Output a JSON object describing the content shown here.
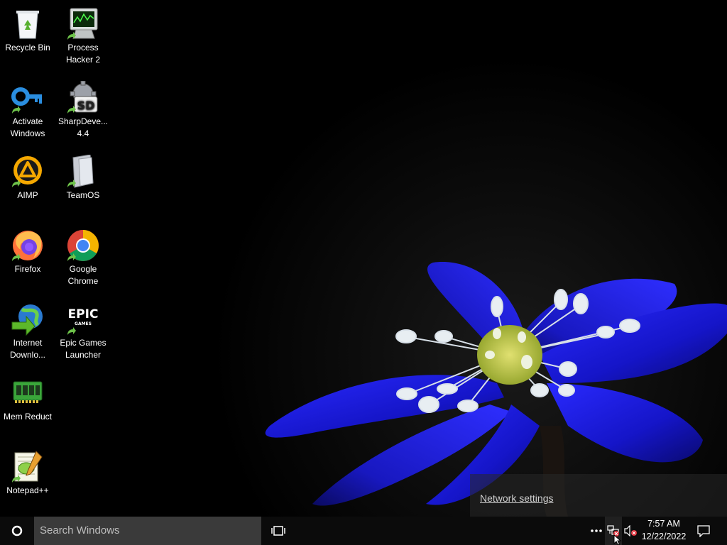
{
  "desktop": {
    "icons": [
      {
        "id": "recycle-bin",
        "label": "Recycle Bin",
        "icon": "recycle-bin-icon",
        "shortcut": false
      },
      {
        "id": "process-hacker",
        "label": "Process Hacker 2",
        "icon": "process-hacker-icon",
        "shortcut": true
      },
      {
        "id": "activate-windows",
        "label": "Activate Windows",
        "icon": "key-icon",
        "shortcut": true
      },
      {
        "id": "sharpdevelop",
        "label": "SharpDeve... 4.4",
        "icon": "sharpdevelop-icon",
        "shortcut": true
      },
      {
        "id": "aimp",
        "label": "AIMP",
        "icon": "aimp-icon",
        "shortcut": true
      },
      {
        "id": "teamos",
        "label": "TeamOS",
        "icon": "teamos-icon",
        "shortcut": true
      },
      {
        "id": "firefox",
        "label": "Firefox",
        "icon": "firefox-icon",
        "shortcut": true
      },
      {
        "id": "google-chrome",
        "label": "Google Chrome",
        "icon": "chrome-icon",
        "shortcut": true
      },
      {
        "id": "internet-download",
        "label": "Internet Downlo...",
        "icon": "internet-download-manager-icon",
        "shortcut": true
      },
      {
        "id": "epic-games",
        "label": "Epic Games Launcher",
        "icon": "epic-games-icon",
        "shortcut": true,
        "logo_text": "EPIC",
        "logo_sub": "GAMES"
      },
      {
        "id": "mem-reduct",
        "label": "Mem Reduct",
        "icon": "memory-chip-icon",
        "shortcut": true
      },
      {
        "id": "notepadpp",
        "label": "Notepad++",
        "icon": "notepadpp-icon",
        "shortcut": true
      }
    ]
  },
  "network_flyout": {
    "link_label": "Network settings"
  },
  "taskbar": {
    "start_icon": "cortana-circle-icon",
    "search_placeholder": "Search Windows",
    "task_view_icon": "task-view-icon",
    "tray": {
      "overflow_icon": "more-dots-icon",
      "network_icon": "network-disconnected-icon",
      "volume_icon": "volume-muted-icon"
    },
    "clock": {
      "time": "7:57 AM",
      "date": "12/22/2022"
    },
    "action_center_icon": "action-center-icon"
  },
  "colors": {
    "taskbar": "#0b0b0b",
    "search_box": "#3a3a3a",
    "petal_blue": "#1a1ae0",
    "flower_center": "#c8d050",
    "error_red": "#e0303a"
  }
}
